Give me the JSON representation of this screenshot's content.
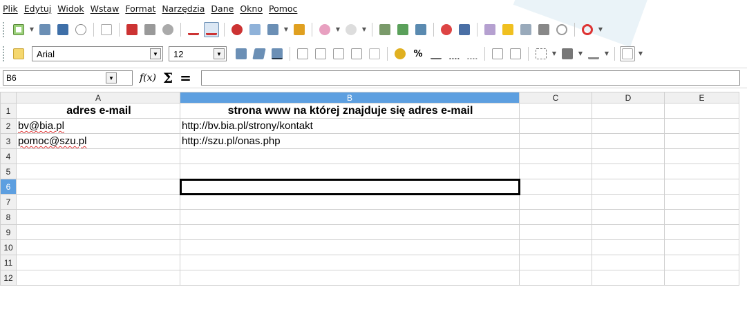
{
  "menu": [
    "Plik",
    "Edytuj",
    "Widok",
    "Wstaw",
    "Format",
    "Narzędzia",
    "Dane",
    "Okno",
    "Pomoc"
  ],
  "format_toolbar": {
    "font_name": "Arial",
    "font_size": "12"
  },
  "formula_bar": {
    "cell_ref": "B6",
    "function_wizard": "f(x)",
    "sum_symbol": "Σ",
    "equals_symbol": "=",
    "content": ""
  },
  "columns": [
    "A",
    "B",
    "C",
    "D",
    "E"
  ],
  "rows": [
    "1",
    "2",
    "3",
    "4",
    "5",
    "6",
    "7",
    "8",
    "9",
    "10",
    "11",
    "12"
  ],
  "cells": {
    "A1": "adres e-mail",
    "B1": "strona www na której znajduje się adres e-mail",
    "A2": "bv@bia.pl",
    "B2": "http://bv.bia.pl/strony/kontakt",
    "A3": "pomoc@szu.pl",
    "B3": "http://szu.pl/onas.php"
  },
  "selection": {
    "active_cell": "B6",
    "active_row": "6",
    "active_column": "B"
  },
  "colors": {
    "header_active": "#5d9fe0"
  }
}
